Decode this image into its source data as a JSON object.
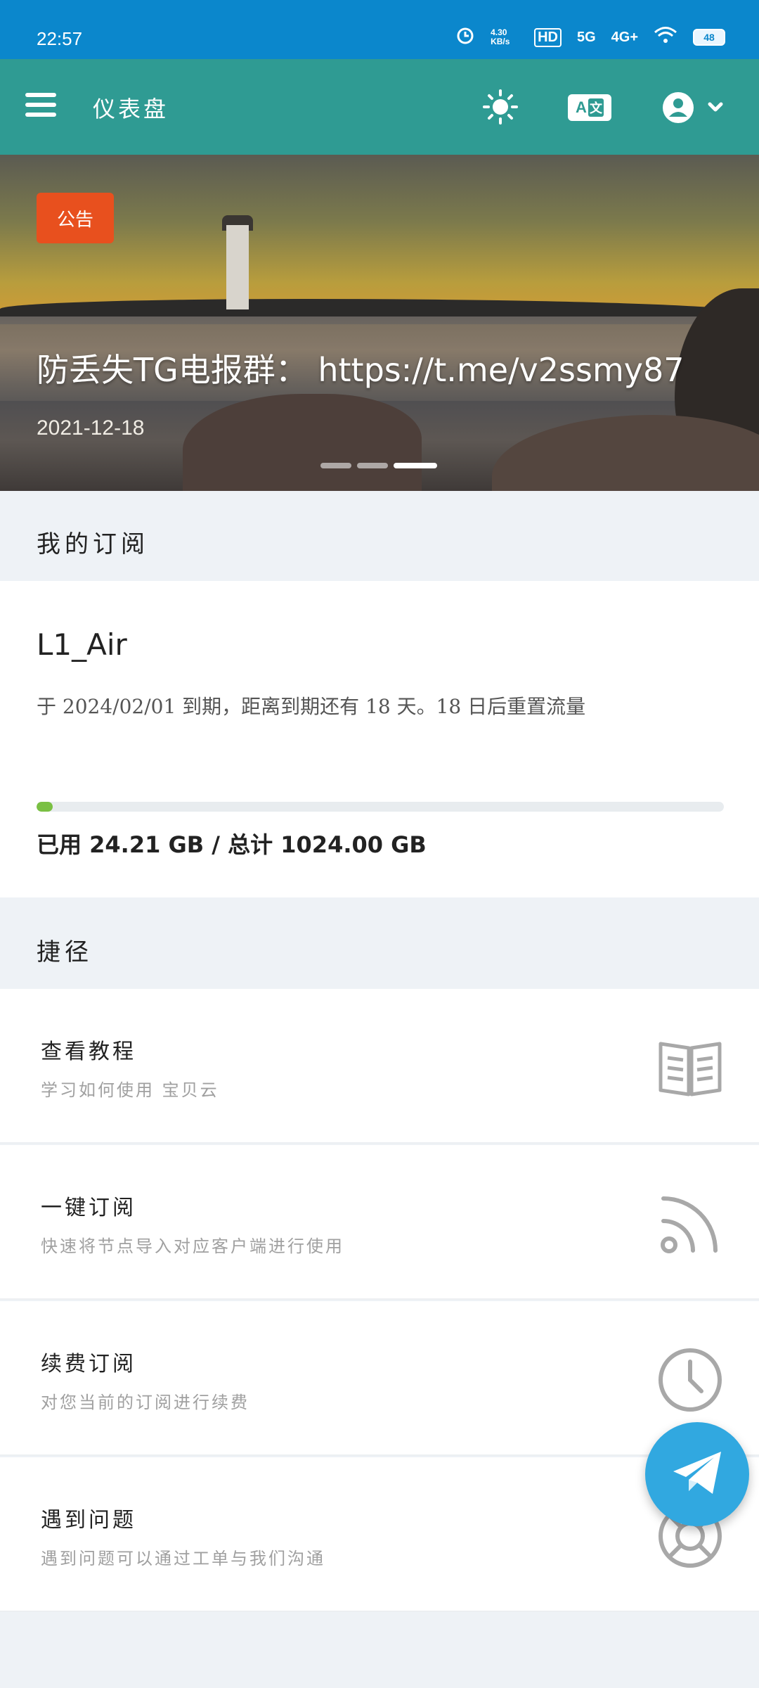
{
  "status_bar": {
    "time": "22:57",
    "net_speed": "4.30 KB/s",
    "hd": "HD",
    "network_5g": "5G",
    "network_4g": "4G+",
    "battery": "48"
  },
  "app_bar": {
    "title": "仪表盘",
    "icons": [
      "menu-icon",
      "sun-icon",
      "translate-icon",
      "user-icon"
    ],
    "lang_label_a": "A",
    "lang_label_b": "文"
  },
  "banner": {
    "tag": "公告",
    "headline": "防丢失TG电报群： https://t.me/v2ssmy87",
    "date": "2021-12-18",
    "slides": 3,
    "active_slide": 3
  },
  "sections": {
    "my_subscription": "我的订阅",
    "shortcuts": "捷径"
  },
  "subscription": {
    "name": "L1_Air",
    "description": "于 2024/02/01 到期，距离到期还有 18 天。18 日后重置流量",
    "used_fraction": 0.0236,
    "usage_text": "已用 24.21 GB / 总计 1024.00 GB"
  },
  "shortcuts": [
    {
      "title": "查看教程",
      "subtitle": "学习如何使用 宝贝云",
      "icon": "book-icon"
    },
    {
      "title": "一键订阅",
      "subtitle": "快速将节点导入对应客户端进行使用",
      "icon": "rss-icon"
    },
    {
      "title": "续费订阅",
      "subtitle": "对您当前的订阅进行续费",
      "icon": "clock-icon"
    },
    {
      "title": "遇到问题",
      "subtitle": "遇到问题可以通过工单与我们沟通",
      "icon": "lifebuoy-icon"
    }
  ],
  "colors": {
    "status_bar": "#0b87cc",
    "app_bar": "#2f9b93",
    "tag": "#e8501e",
    "progress": "#7ac043",
    "fab": "#31a8e0"
  }
}
